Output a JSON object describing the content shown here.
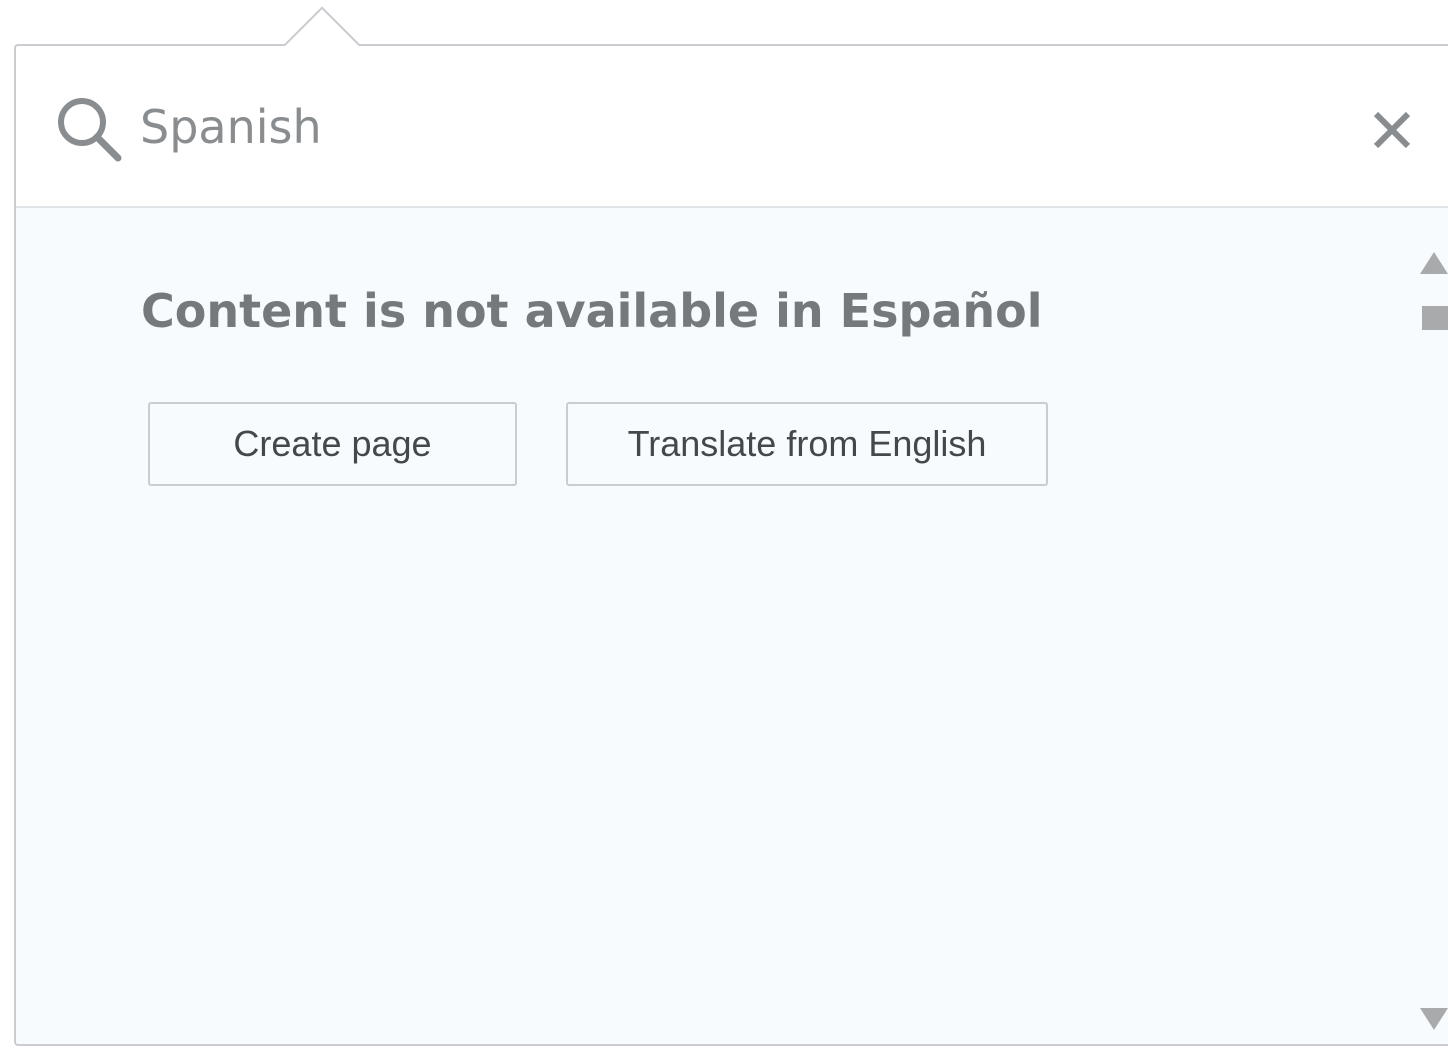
{
  "search": {
    "value": "Spanish",
    "placeholder": "Spanish"
  },
  "main": {
    "message": "Content is not available in Español",
    "buttons": {
      "create_label": "Create page",
      "translate_label": "Translate from English"
    }
  },
  "icons": {
    "search": "search-icon",
    "close": "close-icon",
    "scroll_up": "triangle-up-icon",
    "scroll_down": "triangle-down-icon"
  },
  "colors": {
    "border": "#c9ccd0",
    "panel_background": "#f8fbfd",
    "text_muted": "#8a8d90",
    "message_text": "#76797c",
    "button_text": "#45484b"
  }
}
